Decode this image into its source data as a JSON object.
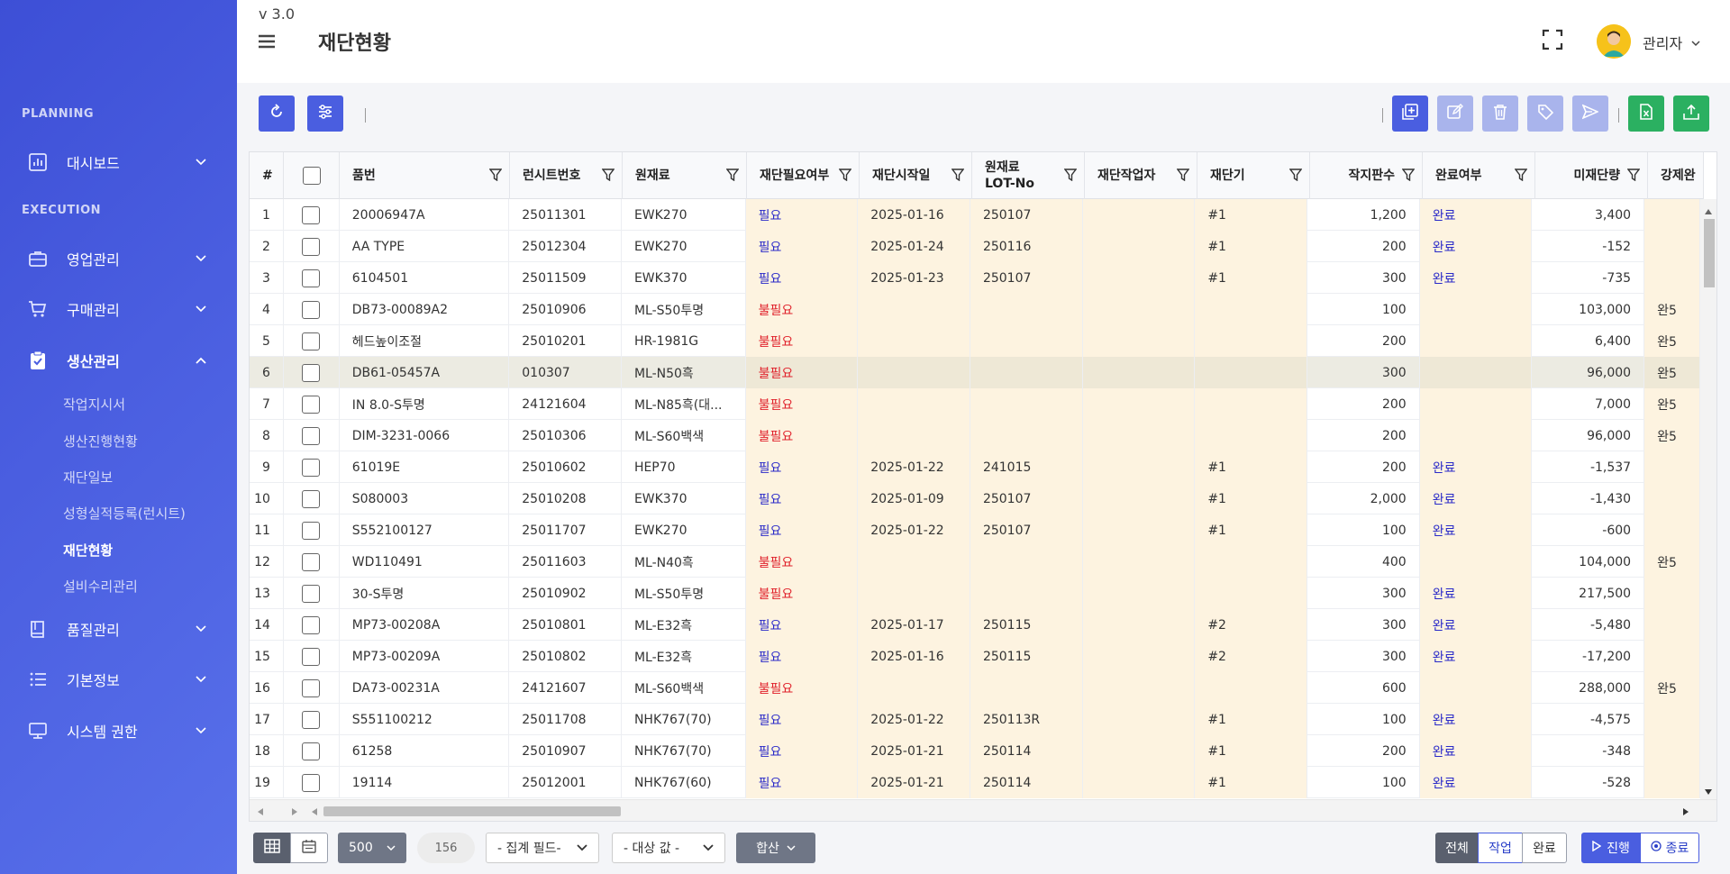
{
  "app": {
    "version": "v 3.0",
    "page_title": "재단현황",
    "user_name": "관리자"
  },
  "colors": {
    "primary": "#4a5ee0",
    "excel_green": "#2bb061",
    "need_blue": "#2a2ac8",
    "noneed_red": "#e0202a",
    "highlight": "#fdf3e0"
  },
  "sidebar": {
    "planning_label": "PLANNING",
    "execution_label": "EXECUTION",
    "dashboard": "대시보드",
    "sales": "영업관리",
    "purchase": "구매관리",
    "production": "생산관리",
    "production_sub": [
      "작업지시서",
      "생산진행현황",
      "재단일보",
      "성형실적등록(런시트)",
      "재단현황",
      "설비수리관리"
    ],
    "quality": "품질관리",
    "basic": "기본정보",
    "system": "시스템 권한"
  },
  "grid": {
    "headers": {
      "no": "#",
      "part": "품번",
      "runsheet": "런시트번호",
      "material": "원재료",
      "need": "재단필요여부",
      "start": "재단시작일",
      "lot": "원재료 LOT-No",
      "worker": "재단작업자",
      "machine": "재단기",
      "plates": "작지판수",
      "complete": "완료여부",
      "remain": "미재단량",
      "force": "강제완"
    },
    "rows": [
      {
        "no": "1",
        "part": "20006947A",
        "runsheet": "25011301",
        "material": "EWK270",
        "need": "필요",
        "start": "2025-01-16",
        "lot": "250107",
        "worker": "",
        "machine": "#1",
        "plates": "1,200",
        "complete": "완료",
        "remain": "3,400",
        "force": ""
      },
      {
        "no": "2",
        "part": "AA TYPE",
        "runsheet": "25012304",
        "material": "EWK270",
        "need": "필요",
        "start": "2025-01-24",
        "lot": "250116",
        "worker": "",
        "machine": "#1",
        "plates": "200",
        "complete": "완료",
        "remain": "-152",
        "force": ""
      },
      {
        "no": "3",
        "part": "6104501",
        "runsheet": "25011509",
        "material": "EWK370",
        "need": "필요",
        "start": "2025-01-23",
        "lot": "250107",
        "worker": "",
        "machine": "#1",
        "plates": "300",
        "complete": "완료",
        "remain": "-735",
        "force": ""
      },
      {
        "no": "4",
        "part": "DB73-00089A2",
        "runsheet": "25010906",
        "material": "ML-S50투명",
        "need": "불필요",
        "start": "",
        "lot": "",
        "worker": "",
        "machine": "",
        "plates": "100",
        "complete": "",
        "remain": "103,000",
        "force": "완5"
      },
      {
        "no": "5",
        "part": "헤드높이조절",
        "runsheet": "25010201",
        "material": "HR-1981G",
        "need": "불필요",
        "start": "",
        "lot": "",
        "worker": "",
        "machine": "",
        "plates": "200",
        "complete": "",
        "remain": "6,400",
        "force": "완5"
      },
      {
        "no": "6",
        "part": "DB61-05457A",
        "runsheet": "010307",
        "material": "ML-N50흑",
        "need": "불필요",
        "start": "",
        "lot": "",
        "worker": "",
        "machine": "",
        "plates": "300",
        "complete": "",
        "remain": "96,000",
        "force": "완5"
      },
      {
        "no": "7",
        "part": "IN 8.0-S투명",
        "runsheet": "24121604",
        "material": "ML-N85흑(대...",
        "need": "불필요",
        "start": "",
        "lot": "",
        "worker": "",
        "machine": "",
        "plates": "200",
        "complete": "",
        "remain": "7,000",
        "force": "완5"
      },
      {
        "no": "8",
        "part": "DIM-3231-0066",
        "runsheet": "25010306",
        "material": "ML-S60백색",
        "need": "불필요",
        "start": "",
        "lot": "",
        "worker": "",
        "machine": "",
        "plates": "200",
        "complete": "",
        "remain": "96,000",
        "force": "완5"
      },
      {
        "no": "9",
        "part": "61019E",
        "runsheet": "25010602",
        "material": "HEP70",
        "need": "필요",
        "start": "2025-01-22",
        "lot": "241015",
        "worker": "",
        "machine": "#1",
        "plates": "200",
        "complete": "완료",
        "remain": "-1,537",
        "force": ""
      },
      {
        "no": "10",
        "part": "S080003",
        "runsheet": "25010208",
        "material": "EWK370",
        "need": "필요",
        "start": "2025-01-09",
        "lot": "250107",
        "worker": "",
        "machine": "#1",
        "plates": "2,000",
        "complete": "완료",
        "remain": "-1,430",
        "force": ""
      },
      {
        "no": "11",
        "part": "S552100127",
        "runsheet": "25011707",
        "material": "EWK270",
        "need": "필요",
        "start": "2025-01-22",
        "lot": "250107",
        "worker": "",
        "machine": "#1",
        "plates": "100",
        "complete": "완료",
        "remain": "-600",
        "force": ""
      },
      {
        "no": "12",
        "part": "WD110491",
        "runsheet": "25011603",
        "material": "ML-N40흑",
        "need": "불필요",
        "start": "",
        "lot": "",
        "worker": "",
        "machine": "",
        "plates": "400",
        "complete": "",
        "remain": "104,000",
        "force": "완5"
      },
      {
        "no": "13",
        "part": "30-S투명",
        "runsheet": "25010902",
        "material": "ML-S50투명",
        "need": "불필요",
        "start": "",
        "lot": "",
        "worker": "",
        "machine": "",
        "plates": "300",
        "complete": "완료",
        "remain": "217,500",
        "force": ""
      },
      {
        "no": "14",
        "part": "MP73-00208A",
        "runsheet": "25010801",
        "material": "ML-E32흑",
        "need": "필요",
        "start": "2025-01-17",
        "lot": "250115",
        "worker": "",
        "machine": "#2",
        "plates": "300",
        "complete": "완료",
        "remain": "-5,480",
        "force": ""
      },
      {
        "no": "15",
        "part": "MP73-00209A",
        "runsheet": "25010802",
        "material": "ML-E32흑",
        "need": "필요",
        "start": "2025-01-16",
        "lot": "250115",
        "worker": "",
        "machine": "#2",
        "plates": "300",
        "complete": "완료",
        "remain": "-17,200",
        "force": ""
      },
      {
        "no": "16",
        "part": "DA73-00231A",
        "runsheet": "24121607",
        "material": "ML-S60백색",
        "need": "불필요",
        "start": "",
        "lot": "",
        "worker": "",
        "machine": "",
        "plates": "600",
        "complete": "",
        "remain": "288,000",
        "force": "완5"
      },
      {
        "no": "17",
        "part": "S551100212",
        "runsheet": "25011708",
        "material": "NHK767(70)",
        "need": "필요",
        "start": "2025-01-22",
        "lot": "250113R",
        "worker": "",
        "machine": "#1",
        "plates": "100",
        "complete": "완료",
        "remain": "-4,575",
        "force": ""
      },
      {
        "no": "18",
        "part": "61258",
        "runsheet": "25010907",
        "material": "NHK767(70)",
        "need": "필요",
        "start": "2025-01-21",
        "lot": "250114",
        "worker": "",
        "machine": "#1",
        "plates": "200",
        "complete": "완료",
        "remain": "-348",
        "force": ""
      },
      {
        "no": "19",
        "part": "19114",
        "runsheet": "25012001",
        "material": "NHK767(60)",
        "need": "필요",
        "start": "2025-01-21",
        "lot": "250114",
        "worker": "",
        "machine": "#1",
        "plates": "100",
        "complete": "완료",
        "remain": "-528",
        "force": ""
      }
    ]
  },
  "footer": {
    "page_size": "500",
    "total_count": "156",
    "agg_field": "- 집계 필드-",
    "target_value": "- 대상 값 -",
    "sum": "합산",
    "filter_all": "전체",
    "filter_work": "작업",
    "filter_done": "완료",
    "status_progress": "진행",
    "status_end": "종료"
  }
}
